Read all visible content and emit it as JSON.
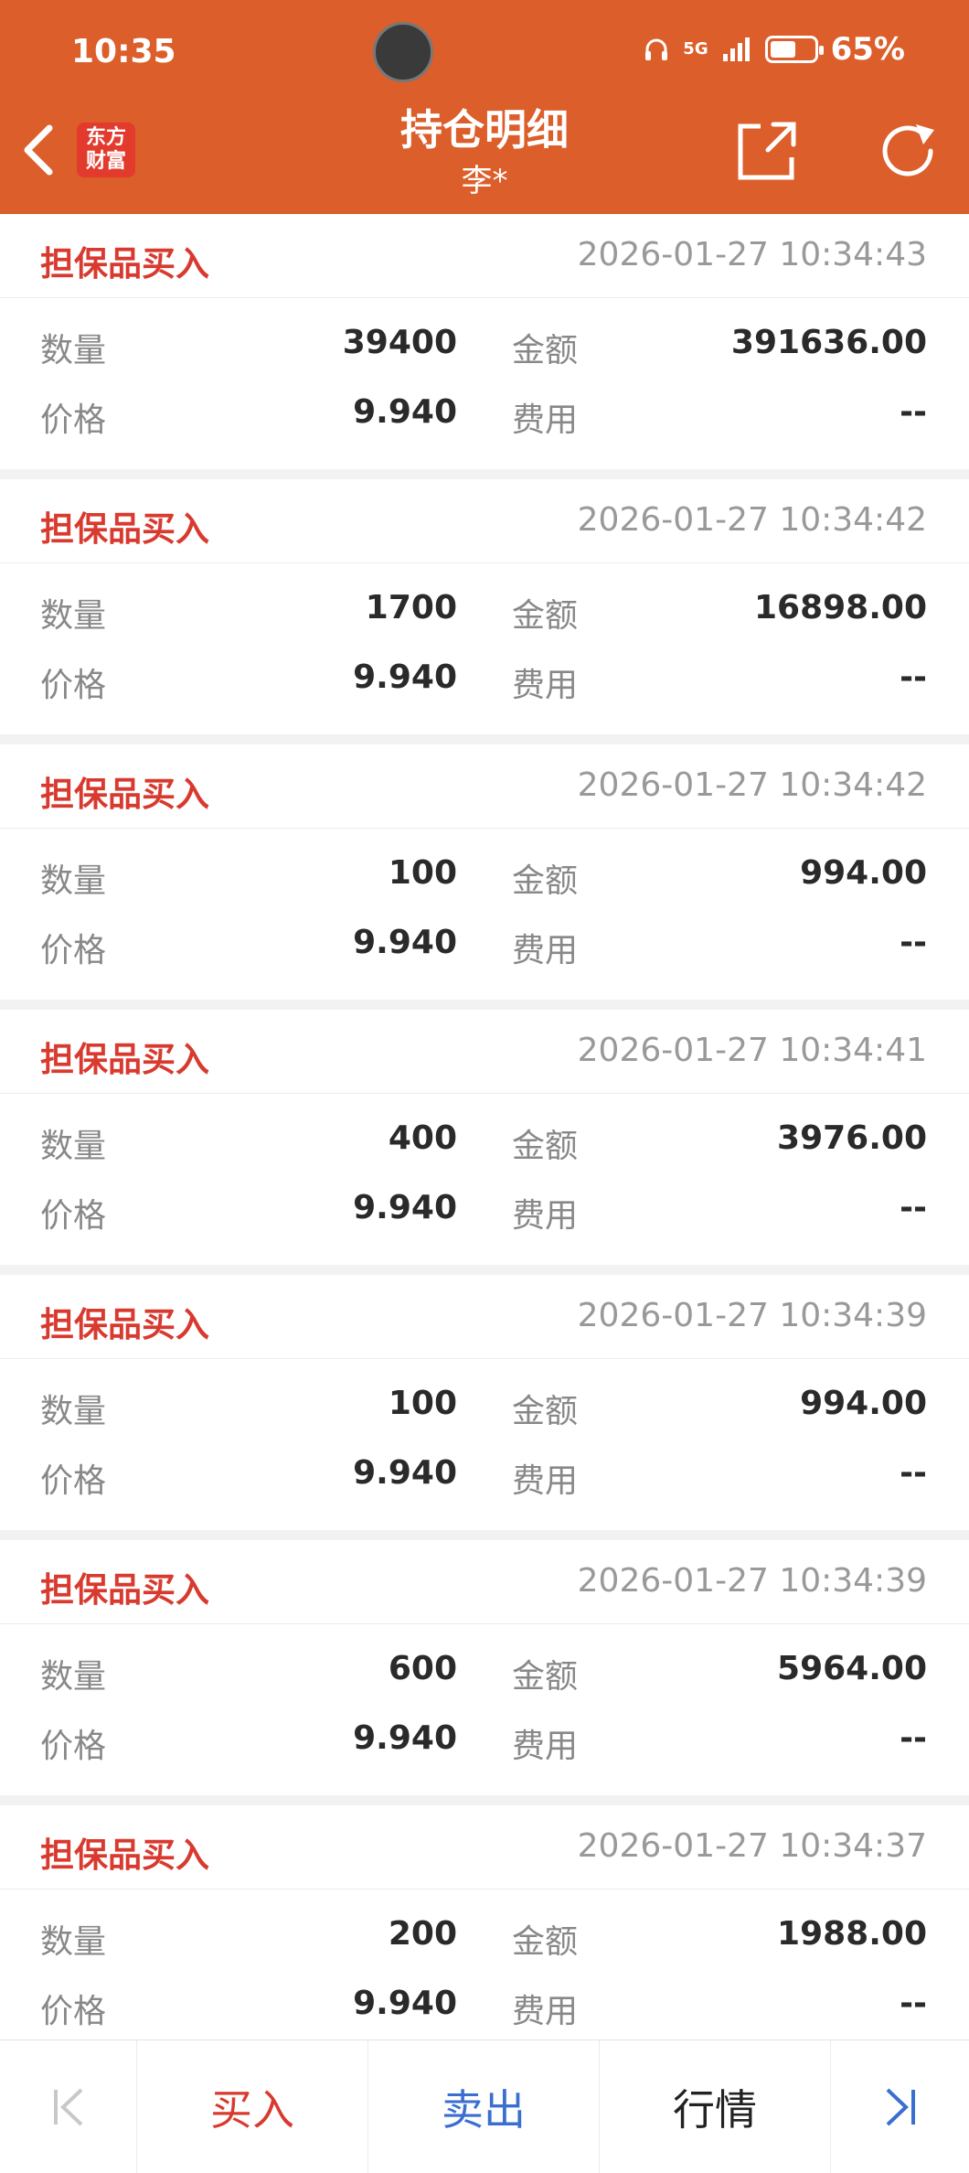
{
  "status_bar": {
    "time": "10:35",
    "network": "5G",
    "battery": "65%",
    "battery_level": 0.65
  },
  "header": {
    "title": "持仓明细",
    "subtitle": "李*",
    "logo_text": [
      "东方",
      "财富"
    ],
    "accent_color": "#dc5e2a"
  },
  "labels": {
    "quantity": "数量",
    "amount": "金额",
    "price": "价格",
    "fee": "费用"
  },
  "trades": [
    {
      "type": "担保品买入",
      "time": "2026-01-27 10:34:43",
      "quantity": "39400",
      "amount": "391636.00",
      "price": "9.940",
      "fee": "--"
    },
    {
      "type": "担保品买入",
      "time": "2026-01-27 10:34:42",
      "quantity": "1700",
      "amount": "16898.00",
      "price": "9.940",
      "fee": "--"
    },
    {
      "type": "担保品买入",
      "time": "2026-01-27 10:34:42",
      "quantity": "100",
      "amount": "994.00",
      "price": "9.940",
      "fee": "--"
    },
    {
      "type": "担保品买入",
      "time": "2026-01-27 10:34:41",
      "quantity": "400",
      "amount": "3976.00",
      "price": "9.940",
      "fee": "--"
    },
    {
      "type": "担保品买入",
      "time": "2026-01-27 10:34:39",
      "quantity": "100",
      "amount": "994.00",
      "price": "9.940",
      "fee": "--"
    },
    {
      "type": "担保品买入",
      "time": "2026-01-27 10:34:39",
      "quantity": "600",
      "amount": "5964.00",
      "price": "9.940",
      "fee": "--"
    },
    {
      "type": "担保品买入",
      "time": "2026-01-27 10:34:37",
      "quantity": "200",
      "amount": "1988.00",
      "price": "9.940",
      "fee": "--"
    }
  ],
  "bottom_bar": {
    "first": "|<",
    "buy": "买入",
    "sell": "卖出",
    "quote": "行情",
    "last": ">|"
  },
  "icons": {
    "back": "chevron-left-icon",
    "share": "share-icon",
    "refresh": "refresh-icon"
  }
}
